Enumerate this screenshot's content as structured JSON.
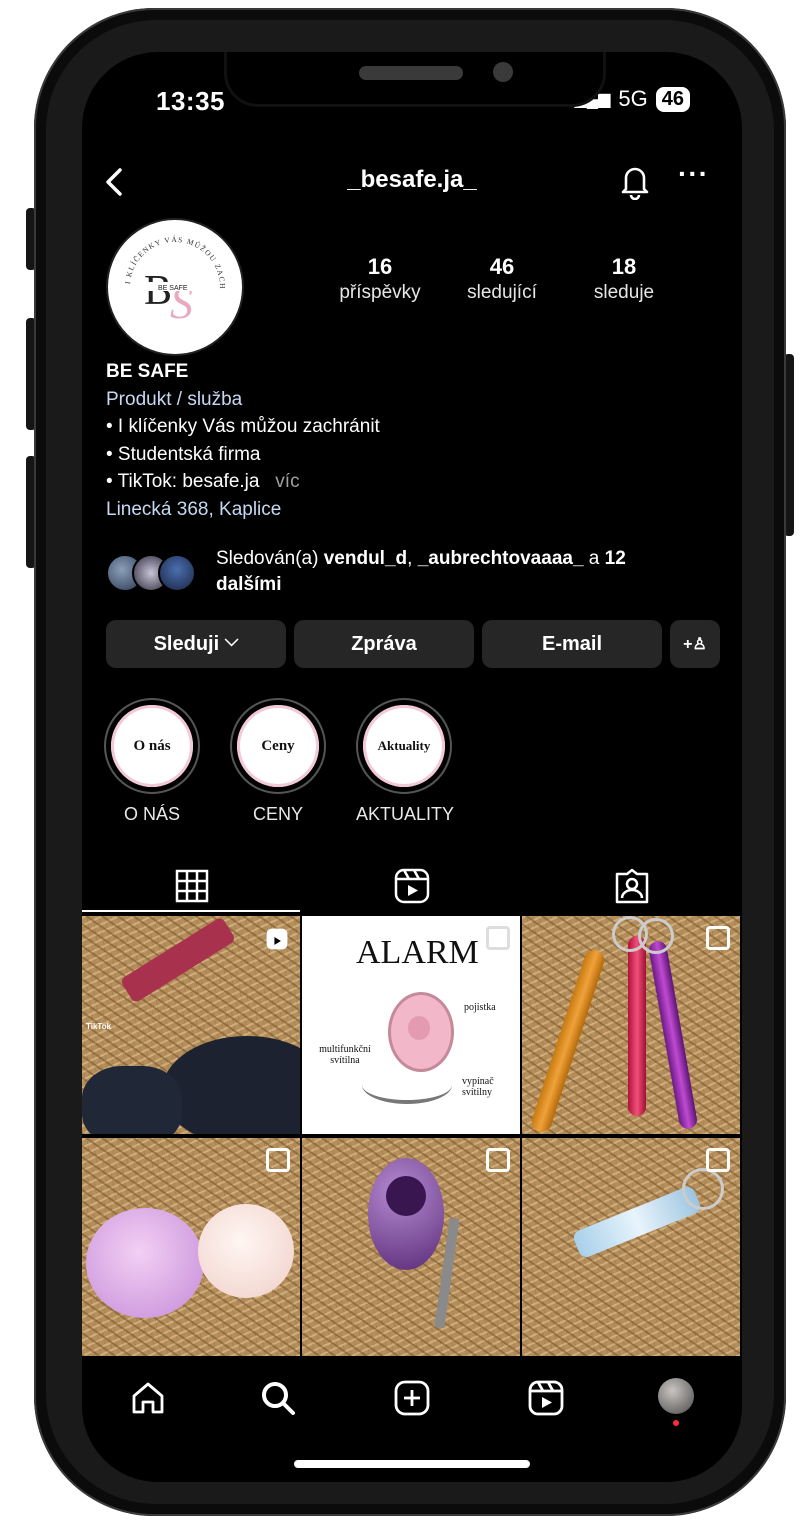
{
  "status": {
    "time": "13:35",
    "network": "5G",
    "battery": "46"
  },
  "profile": {
    "username": "_besafe.ja_",
    "logo_text": "I KLÍČENKY VÁS MŮŽOU ZACHRÁNIT",
    "logo_badge": "BE SAFE",
    "stats": [
      {
        "value": "16",
        "label": "příspěvky"
      },
      {
        "value": "46",
        "label": "sledující"
      },
      {
        "value": "18",
        "label": "sleduje"
      }
    ],
    "name": "BE SAFE",
    "category": "Produkt / služba",
    "bio_lines": [
      "• I klíčenky Vás můžou zachránit",
      "• Studentská firma",
      "• TikTok: besafe.ja"
    ],
    "more_label": "víc",
    "location": "Linecká 368, Kaplice"
  },
  "followed_by": {
    "prefix": "Sledován(a) ",
    "users": "vendul_d",
    "sep": ", ",
    "users2": "_aubrechtovaaaa_",
    "and": " a ",
    "count": "12",
    "suffix": "dalšími"
  },
  "actions": {
    "follow": "Sleduji",
    "follow_chevron": "⌵",
    "message": "Zpráva",
    "email": "E-mail",
    "add_person": "+♙"
  },
  "highlights": [
    {
      "inner": "O nás",
      "caption": "O NÁS"
    },
    {
      "inner": "Ceny",
      "caption": "CENY"
    },
    {
      "inner": "Aktuality",
      "caption": "AKTUALITY"
    }
  ],
  "tabs": [
    "grid-icon",
    "reels-icon",
    "tagged-icon"
  ],
  "posts": [
    {
      "type": "reel",
      "tiktok": "TikTok"
    },
    {
      "type": "carousel",
      "title": "ALARM",
      "labels": [
        "pojistka",
        "multifunkční svítilna",
        "vypínač svítilny"
      ]
    },
    {
      "type": "carousel"
    },
    {
      "type": "carousel"
    },
    {
      "type": "carousel"
    },
    {
      "type": "carousel"
    }
  ],
  "colors": {
    "background": "#000000",
    "button": "#262626",
    "link_blue": "#c7d8f2",
    "accent_pink": "#e9a9c0",
    "notify_red": "#ff2b3d"
  },
  "nav": [
    "home-icon",
    "search-icon",
    "add-post-icon",
    "reels-icon",
    "profile-avatar"
  ]
}
